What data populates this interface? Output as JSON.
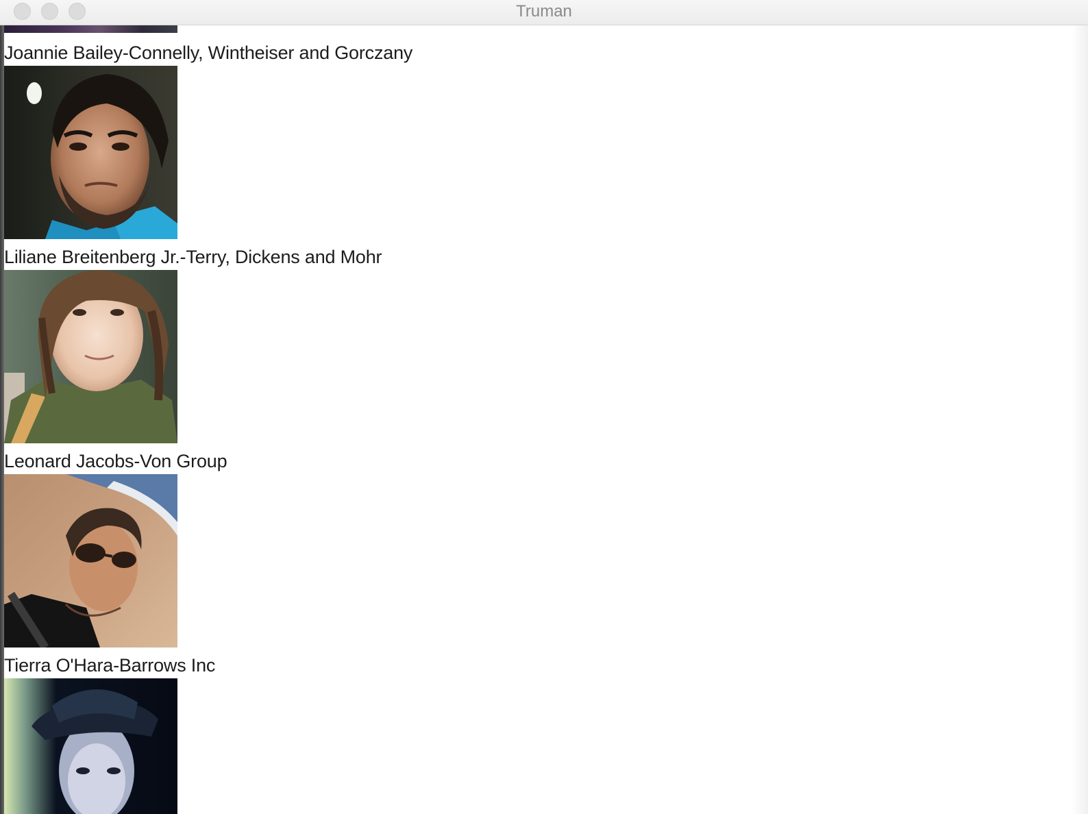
{
  "window": {
    "title": "Truman"
  },
  "list": {
    "entries": [
      {
        "name": "Joannie Bailey-Connelly, Wintheiser and Gorczany",
        "photo": "profile-photo-man-beard-blue-shirt"
      },
      {
        "name": "Liliane Breitenberg Jr.-Terry, Dickens and Mohr",
        "photo": "profile-photo-woman-brown-hair-green-shirt"
      },
      {
        "name": "Leonard Jacobs-Von Group",
        "photo": "profile-photo-man-sunglasses-beach"
      },
      {
        "name": "Tierra O'Hara-Barrows Inc",
        "photo": "profile-photo-man-hat-dark"
      }
    ]
  }
}
